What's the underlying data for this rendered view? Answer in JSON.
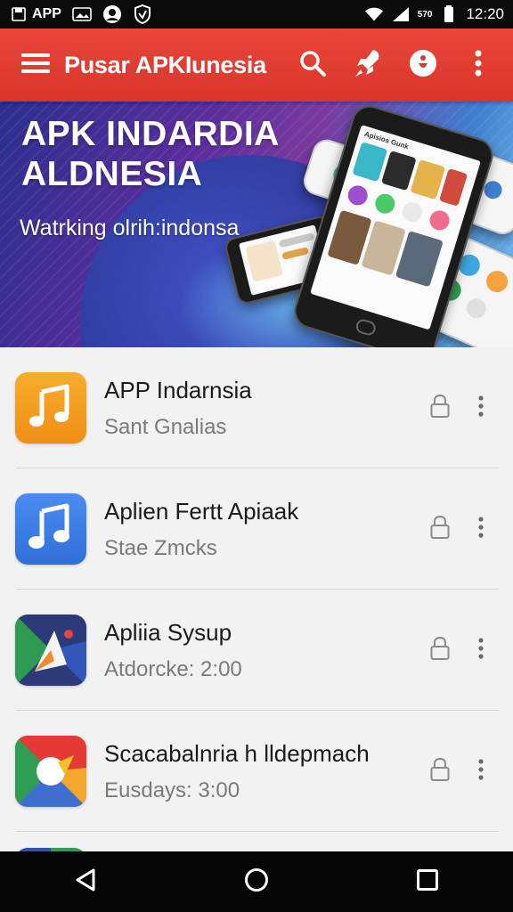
{
  "status_bar": {
    "app_label": "APP",
    "small_label": "570",
    "time": "12:20"
  },
  "app_bar": {
    "title": "Pusar APKIunesia",
    "actions": [
      "search-icon",
      "rocket-icon",
      "info-icon",
      "more-vert-icon"
    ],
    "color": "#e8463a"
  },
  "hero": {
    "title_line1": "APK INDARDIA",
    "title_line2": "ALDNESIA",
    "subtitle": "Watrking olrih:indonsa",
    "phone_header": "Apisios Gunk"
  },
  "apps": [
    {
      "title": "APP Indarnsia",
      "subtitle": "Sant Gnalias",
      "icon": "music-note-orange-icon",
      "color": "#f39a1e"
    },
    {
      "title": "Aplien Fertt  Apiaak",
      "subtitle": "Stae Zmcks",
      "icon": "music-note-blue-icon",
      "color": "#3d7fe0"
    },
    {
      "title": "Apliia Sysup",
      "subtitle": "Atdorcke: 2:00",
      "icon": "triangle-logo-icon",
      "color": "#2d3a7a"
    },
    {
      "title": "Scacabalnria h lldepmach",
      "subtitle": "Eusdays: 3:00",
      "icon": "chrome-like-icon",
      "color": "#e53935"
    }
  ],
  "nav": [
    "back-icon",
    "home-icon",
    "recents-icon"
  ]
}
